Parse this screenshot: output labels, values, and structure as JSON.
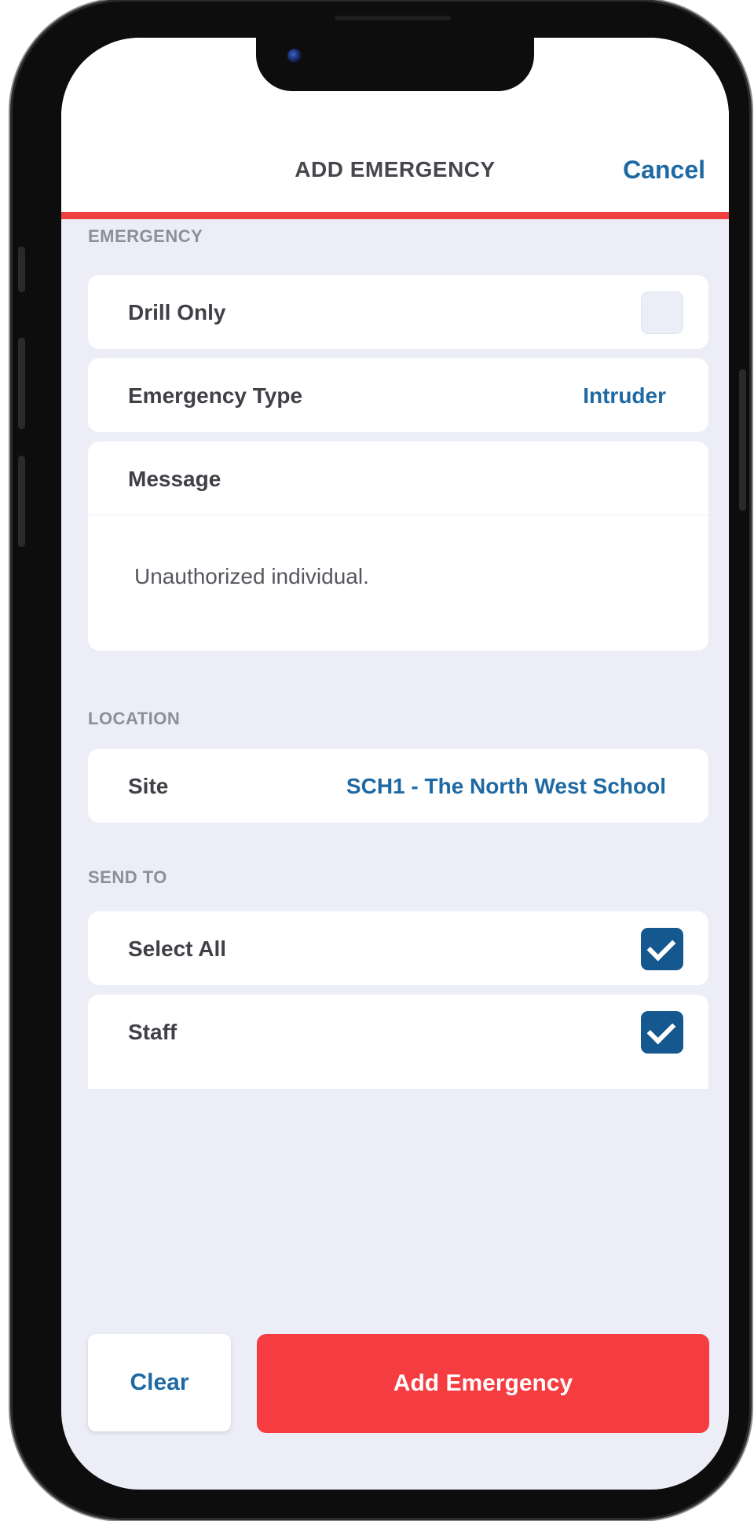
{
  "header": {
    "title": "ADD EMERGENCY",
    "cancel_label": "Cancel"
  },
  "sections": {
    "emergency_label": "EMERGENCY",
    "location_label": "LOCATION",
    "send_to_label": "SEND TO"
  },
  "emergency": {
    "drill_only_label": "Drill Only",
    "drill_only_checked": false,
    "type_label": "Emergency Type",
    "type_value": "Intruder",
    "message_label": "Message",
    "message_value": "Unauthorized individual."
  },
  "location": {
    "site_label": "Site",
    "site_value": "SCH1 - The North West School"
  },
  "send_to": {
    "select_all_label": "Select All",
    "select_all_checked": true,
    "staff_label": "Staff",
    "staff_checked": true
  },
  "actions": {
    "clear_label": "Clear",
    "add_label": "Add Emergency"
  },
  "colors": {
    "accent_red": "#f53c41",
    "header_rule": "#ef4040",
    "link_blue": "#1f69a3",
    "checkbox_blue": "#14588f",
    "background": "#ecedf7"
  }
}
